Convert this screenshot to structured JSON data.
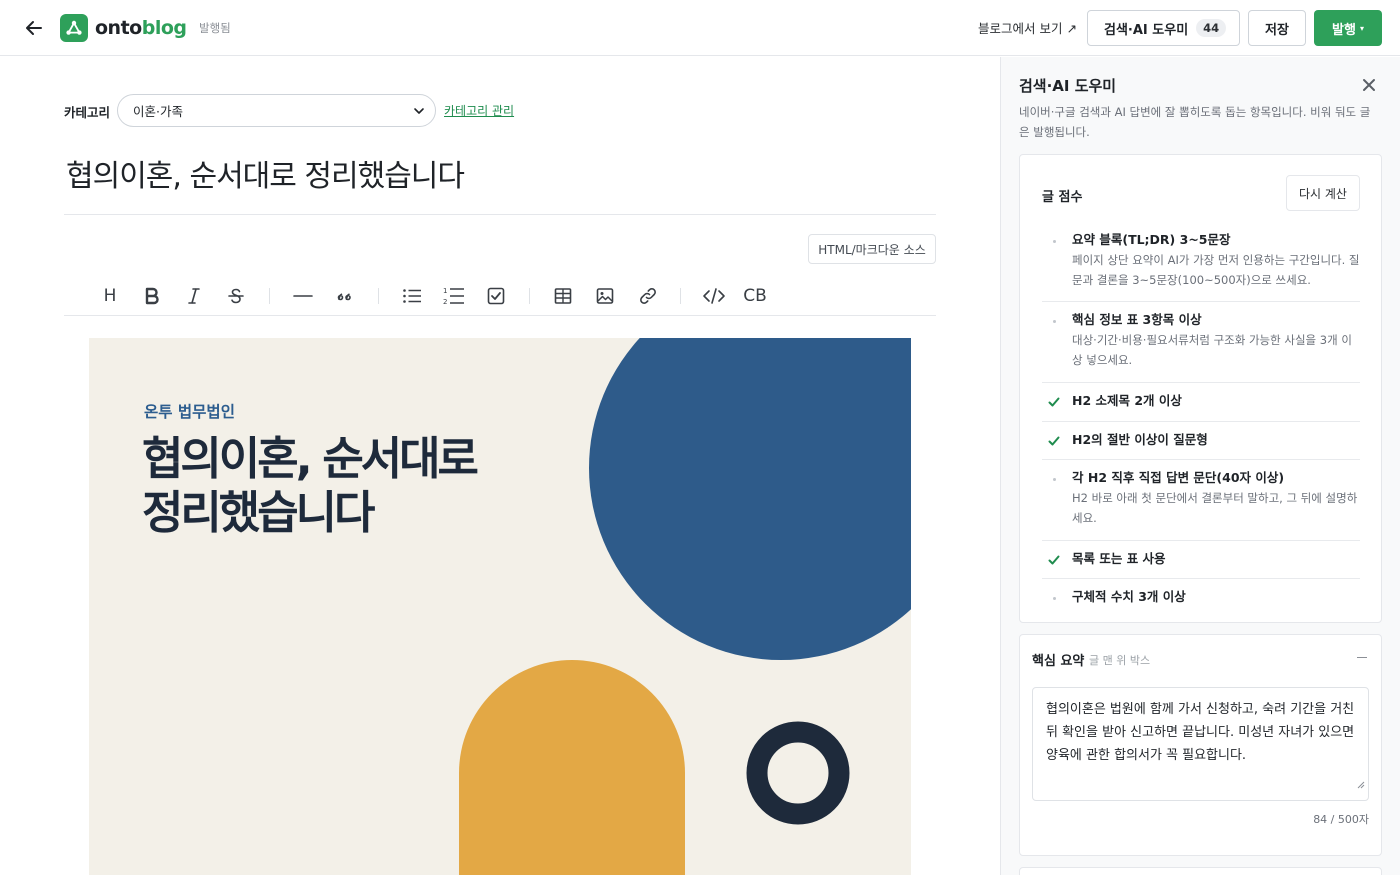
{
  "header": {
    "logo_onto": "onto",
    "logo_blog": "blog",
    "status": "발행됨",
    "view_on_blog": "블로그에서 보기 ↗",
    "ai_button_label": "검색·AI 도우미",
    "ai_score": "44",
    "save_label": "저장",
    "publish_label": "발행",
    "publish_caret": "▾"
  },
  "editor": {
    "category_label": "카테고리",
    "category_value": "이혼·가족",
    "category_manage": "카테고리 관리",
    "post_title": "협의이혼, 순서대로 정리했습니다",
    "source_button": "HTML/마크다운 소스",
    "toolbar": {
      "heading": "H",
      "code_block": "CB"
    },
    "cover": {
      "brand": "온투 법무법인",
      "title_line1": "협의이혼, 순서대로",
      "title_line2": "정리했습니다",
      "colors": {
        "background": "#f3f0e8",
        "blue": "#2e5b8a",
        "yellow": "#e3a845",
        "navy": "#1e2a3b"
      }
    }
  },
  "panel": {
    "title": "검색·AI 도우미",
    "description": "네이버·구글 검색과 AI 답변에 잘 뽑히도록 돕는 항목입니다. 비워 둬도 글은 발행됩니다.",
    "score_title": "글 점수",
    "recalc_label": "다시 계산",
    "checks": [
      {
        "status": "pending",
        "title": "요약 블록(TL;DR) 3~5문장",
        "desc": "페이지 상단 요약이 AI가 가장 먼저 인용하는 구간입니다. 질문과 결론을 3~5문장(100~500자)으로 쓰세요."
      },
      {
        "status": "pending",
        "title": "핵심 정보 표 3항목 이상",
        "desc": "대상·기간·비용·필요서류처럼 구조화 가능한 사실을 3개 이상 넣으세요."
      },
      {
        "status": "done",
        "title": "H2 소제목 2개 이상",
        "desc": ""
      },
      {
        "status": "done",
        "title": "H2의 절반 이상이 질문형",
        "desc": ""
      },
      {
        "status": "pending",
        "title": "각 H2 직후 직접 답변 문단(40자 이상)",
        "desc": "H2 바로 아래 첫 문단에서 결론부터 말하고, 그 뒤에 설명하세요."
      },
      {
        "status": "done",
        "title": "목록 또는 표 사용",
        "desc": ""
      },
      {
        "status": "pending",
        "title": "구체적 수치 3개 이상",
        "desc": ""
      }
    ],
    "summary": {
      "title": "핵심 요약",
      "subtitle": "글 맨 위 박스",
      "text": "협의이혼은 법원에 함께 가서 신청하고, 숙려 기간을 거친 뒤 확인을 받아 신고하면 끝납니다. 미성년 자녀가 있으면 양육에 관한 합의서가 꼭 필요합니다.",
      "counter": "84 / 500자"
    },
    "colors": {
      "accent": "#2ea05a",
      "check": "#1f8c4e"
    }
  }
}
